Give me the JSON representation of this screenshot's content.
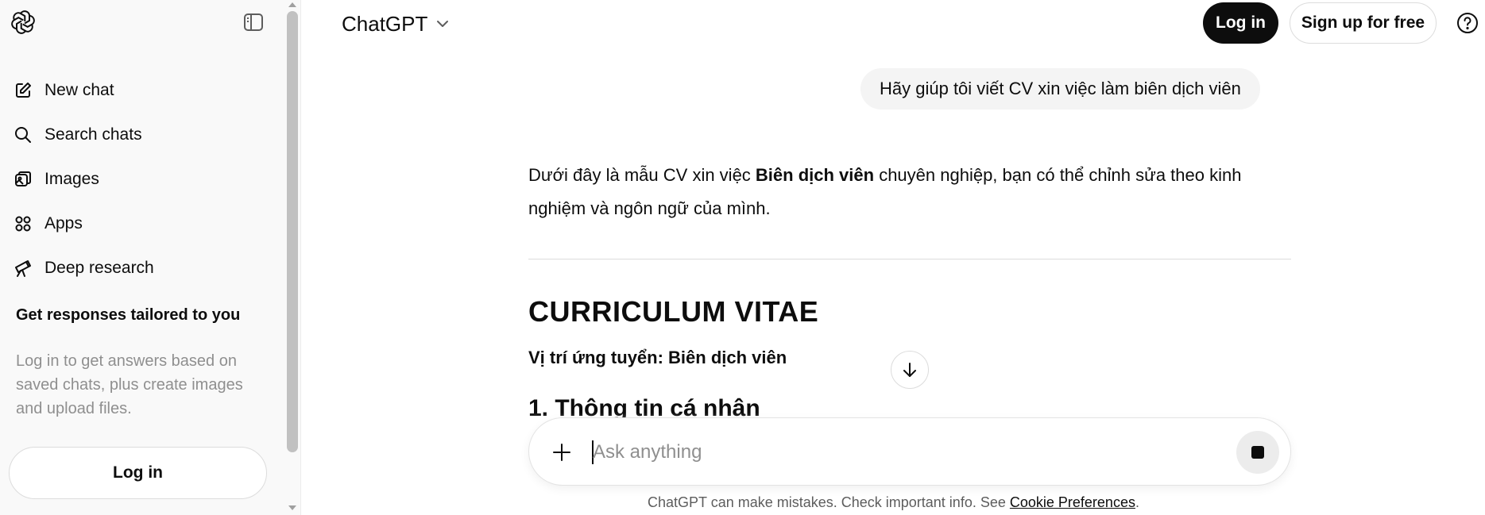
{
  "sidebar": {
    "items": [
      {
        "label": "New chat",
        "icon": "edit-icon"
      },
      {
        "label": "Search chats",
        "icon": "search-icon"
      },
      {
        "label": "Images",
        "icon": "images-icon"
      },
      {
        "label": "Apps",
        "icon": "apps-icon"
      },
      {
        "label": "Deep research",
        "icon": "telescope-icon"
      }
    ],
    "promo_title": "Get responses tailored to you",
    "promo_text": "Log in to get answers based on saved chats, plus create images and upload files.",
    "login_label": "Log in"
  },
  "header": {
    "model": "ChatGPT",
    "login_label": "Log in",
    "signup_label": "Sign up for free"
  },
  "conversation": {
    "user_message": "Hãy giúp tôi viết CV xin việc làm biên dịch viên",
    "answer_intro_before": "Dưới đây là mẫu CV xin việc ",
    "answer_intro_bold": "Biên dịch viên",
    "answer_intro_after": " chuyên nghiệp, bạn có thể chỉnh sửa theo kinh nghiệm và ngôn ngữ của mình.",
    "cv_title": "CURRICULUM VITAE",
    "position_line": "Vị trí ứng tuyển: Biên dịch viên",
    "section_1": "1. Thông tin cá nhân"
  },
  "composer": {
    "placeholder": "Ask anything"
  },
  "footer": {
    "disclaimer": "ChatGPT can make mistakes. Check important info. See ",
    "link": "Cookie Preferences",
    "end": "."
  },
  "colors": {
    "sidebar_bg": "#f9f9f9",
    "bubble_bg": "#f4f4f4",
    "primary_button": "#0d0d0d",
    "muted_text": "#8f8f8f"
  }
}
